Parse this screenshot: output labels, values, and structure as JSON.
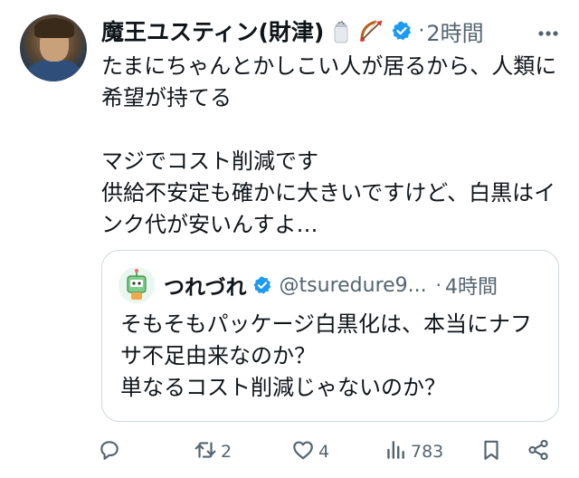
{
  "tweet": {
    "author_name": "魔王ユスティン(財津)",
    "author_emoji": [
      "salt-shaker-emoji",
      "bow-and-arrow-emoji"
    ],
    "time": "2時間",
    "dot": "·",
    "text_lines": [
      "たまにちゃんとかしこい人が居るから、人類に希望が持てる",
      "",
      "マジでコスト削減です",
      "供給不安定も確かに大きいですけど、白黒はインク代が安いんすよ…"
    ]
  },
  "quote": {
    "author_name": "つれづれ",
    "handle": "@tsuredure9...",
    "dot": "·",
    "time": "4時間",
    "text_lines": [
      "そもそもパッケージ白黒化は、本当にナフサ不足由来なのか？",
      "単なるコスト削減じゃないのか？"
    ]
  },
  "actions": {
    "reply_count": "",
    "retweet_count": "2",
    "like_count": "4",
    "views_count": "783"
  },
  "colors": {
    "text": "#0f1419",
    "secondary": "#536471",
    "verified": "#1d9bf0",
    "border": "#cfd9de"
  }
}
